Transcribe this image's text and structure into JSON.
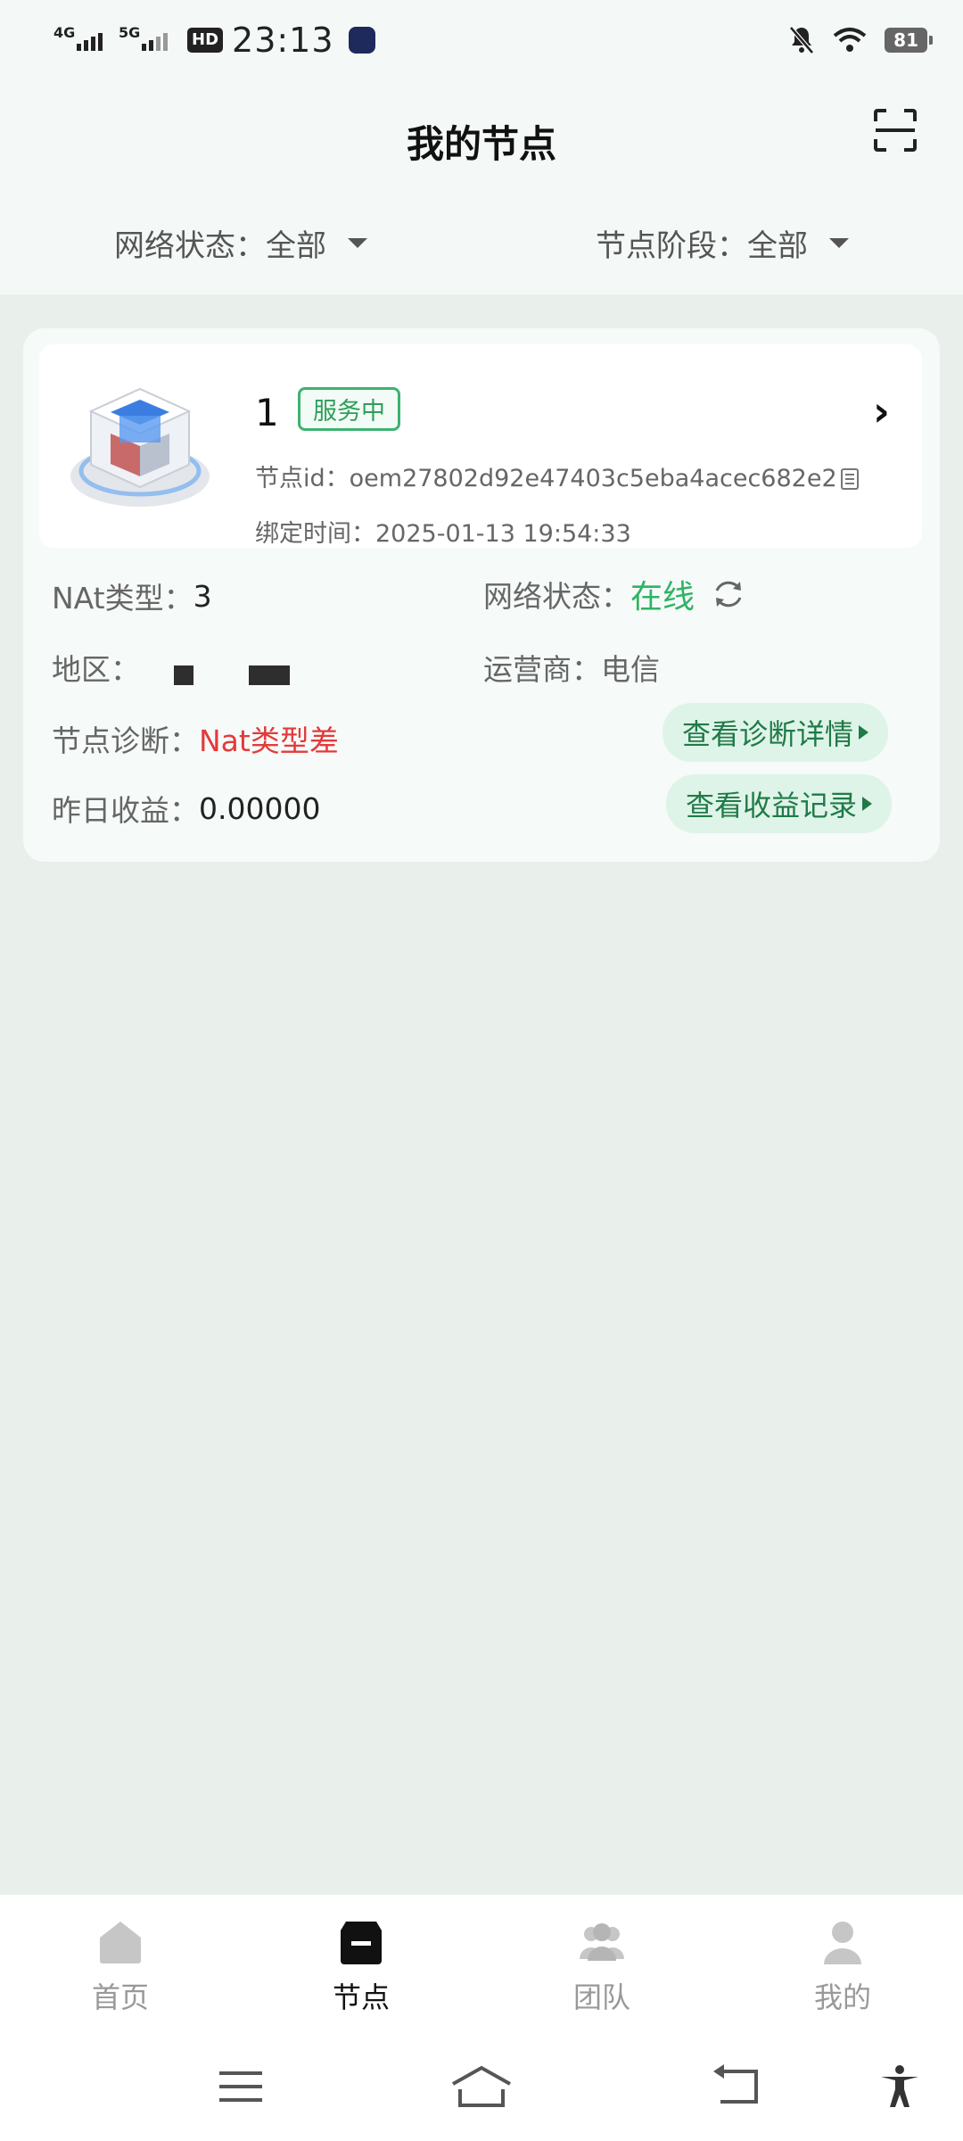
{
  "status_bar": {
    "net1": "4G",
    "net2": "5G",
    "hd": "HD",
    "time": "23:13",
    "battery": "81"
  },
  "header": {
    "title": "我的节点",
    "filters": [
      {
        "label": "网络状态：全部"
      },
      {
        "label": "节点阶段：全部"
      }
    ]
  },
  "node": {
    "number": "1",
    "status_badge": "服务中",
    "id_line": "节点id：oem27802d92e47403c5eba4acec682e2",
    "bind_time_line": "绑定时间：2025-01-13 19:54:33",
    "nat_label": "NAt类型：",
    "nat_value": "3",
    "net_status_label": "网络状态：",
    "net_status_value": "在线",
    "region_label": "地区：",
    "carrier_label": "运营商：",
    "carrier_value": "电信",
    "diagnosis_label": "节点诊断：",
    "diagnosis_value": "Nat类型差",
    "diagnosis_button": "查看诊断详情",
    "earnings_label": "昨日收益：",
    "earnings_value": "0.00000",
    "earnings_button": "查看收益记录"
  },
  "tabs": [
    {
      "label": "首页",
      "icon": "home-icon"
    },
    {
      "label": "节点",
      "icon": "node-icon",
      "active": true
    },
    {
      "label": "团队",
      "icon": "team-icon"
    },
    {
      "label": "我的",
      "icon": "profile-icon"
    }
  ],
  "colors": {
    "accent_green": "#2fb366",
    "warning_red": "#e23b3b",
    "background": "#e9f0ec"
  }
}
